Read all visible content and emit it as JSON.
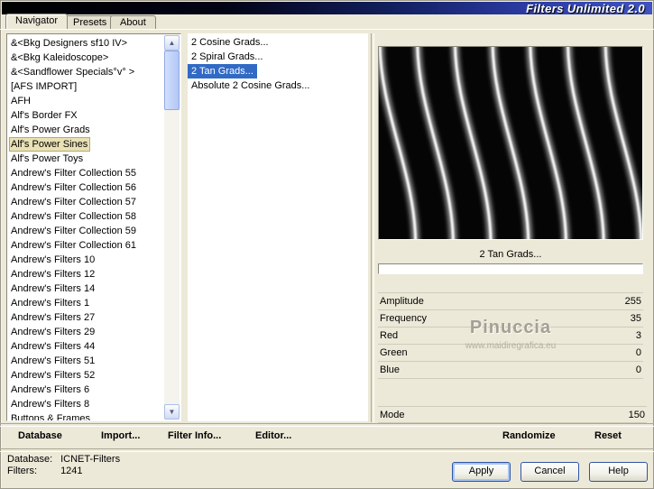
{
  "window": {
    "title": "Filters Unlimited 2.0"
  },
  "tabs": {
    "navigator": "Navigator",
    "presets": "Presets",
    "about": "About"
  },
  "navigator": {
    "items": [
      "&<Bkg Designers sf10 IV>",
      "&<Bkg Kaleidoscope>",
      "&<Sandflower Specials°v° >",
      "[AFS IMPORT]",
      "AFH",
      "Alf's Border FX",
      "Alf's Power Grads",
      "Alf's Power Sines",
      "Alf's Power Toys",
      "Andrew's Filter Collection 55",
      "Andrew's Filter Collection 56",
      "Andrew's Filter Collection 57",
      "Andrew's Filter Collection 58",
      "Andrew's Filter Collection 59",
      "Andrew's Filter Collection 61",
      "Andrew's Filters 10",
      "Andrew's Filters 12",
      "Andrew's Filters 14",
      "Andrew's Filters 1",
      "Andrew's Filters 27",
      "Andrew's Filters 29",
      "Andrew's Filters 44",
      "Andrew's Filters 51",
      "Andrew's Filters 52",
      "Andrew's Filters 6",
      "Andrew's Filters 8",
      "Buttons & Frames"
    ],
    "selected": "Alf's Power Sines"
  },
  "filters": {
    "items": [
      "2 Cosine Grads...",
      "2 Spiral Grads...",
      "2 Tan Grads...",
      "Absolute 2 Cosine Grads..."
    ],
    "selected": "2 Tan Grads..."
  },
  "preview": {
    "caption": "2 Tan Grads...",
    "watermark": "Pinuccia",
    "watermark_url": "www.maidiregrafica.eu"
  },
  "params": [
    {
      "label": "Amplitude",
      "value": "255"
    },
    {
      "label": "Frequency",
      "value": "35"
    },
    {
      "label": "Red",
      "value": "3"
    },
    {
      "label": "Green",
      "value": "0"
    },
    {
      "label": "Blue",
      "value": "0"
    }
  ],
  "mode": {
    "label": "Mode",
    "value": "150"
  },
  "toolbar": {
    "database": "Database",
    "import": "Import...",
    "filter_info": "Filter Info...",
    "editor": "Editor...",
    "randomize": "Randomize",
    "reset": "Reset"
  },
  "status": {
    "database_label": "Database:",
    "database_value": "ICNET-Filters",
    "filters_label": "Filters:",
    "filters_value": "1241"
  },
  "actions": {
    "apply": "Apply",
    "cancel": "Cancel",
    "help": "Help"
  },
  "colors": {
    "selection": "#316ac5",
    "dialog": "#ece9d8",
    "title_end": "#3f54c2"
  }
}
